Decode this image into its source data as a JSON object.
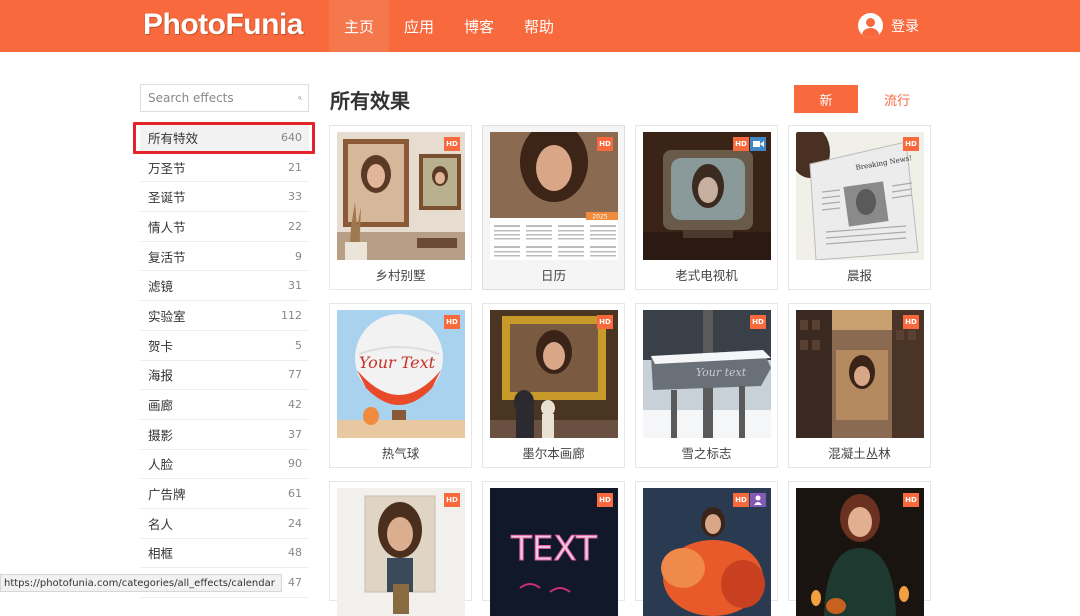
{
  "header": {
    "logo_part1": "Photo",
    "logo_part2": "Funia",
    "nav": [
      "主页",
      "应用",
      "博客",
      "帮助"
    ],
    "active_nav": 0,
    "login": "登录"
  },
  "search": {
    "placeholder": "Search effects"
  },
  "categories": [
    {
      "label": "所有特效",
      "count": "640"
    },
    {
      "label": "万圣节",
      "count": "21"
    },
    {
      "label": "圣诞节",
      "count": "33"
    },
    {
      "label": "情人节",
      "count": "22"
    },
    {
      "label": "复活节",
      "count": "9"
    },
    {
      "label": "滤镜",
      "count": "31"
    },
    {
      "label": "实验室",
      "count": "112"
    },
    {
      "label": "贺卡",
      "count": "5"
    },
    {
      "label": "海报",
      "count": "77"
    },
    {
      "label": "画廊",
      "count": "42"
    },
    {
      "label": "摄影",
      "count": "37"
    },
    {
      "label": "人脸",
      "count": "90"
    },
    {
      "label": "广告牌",
      "count": "61"
    },
    {
      "label": "名人",
      "count": "24"
    },
    {
      "label": "相框",
      "count": "48"
    },
    {
      "label": "",
      "count": "47"
    }
  ],
  "main": {
    "title": "所有效果",
    "sort_new": "新",
    "sort_popular": "流行"
  },
  "effects": [
    {
      "label": "乡村别墅",
      "hd": "HD"
    },
    {
      "label": "日历",
      "hd": "HD",
      "calendar_year": "2025"
    },
    {
      "label": "老式电视机",
      "hd": "HD"
    },
    {
      "label": "晨报",
      "hd": "HD",
      "paper_headline": "Breaking News!"
    },
    {
      "label": "热气球",
      "hd": "HD",
      "balloon_text": "Your Text"
    },
    {
      "label": "墨尔本画廊",
      "hd": "HD"
    },
    {
      "label": "雪之标志",
      "hd": "HD",
      "sign_text": "Your text"
    },
    {
      "label": "混凝土丛林",
      "hd": "HD"
    },
    {
      "label": "",
      "hd": "HD"
    },
    {
      "label": "",
      "hd": "HD",
      "neon_text": "TEXT"
    },
    {
      "label": "",
      "hd": "HD"
    },
    {
      "label": "",
      "hd": "HD"
    }
  ],
  "status_bar": {
    "url": "https://photofunia.com/categories/all_effects/calendar"
  },
  "colors": {
    "accent": "#f8693d",
    "highlight": "#e2232a"
  }
}
